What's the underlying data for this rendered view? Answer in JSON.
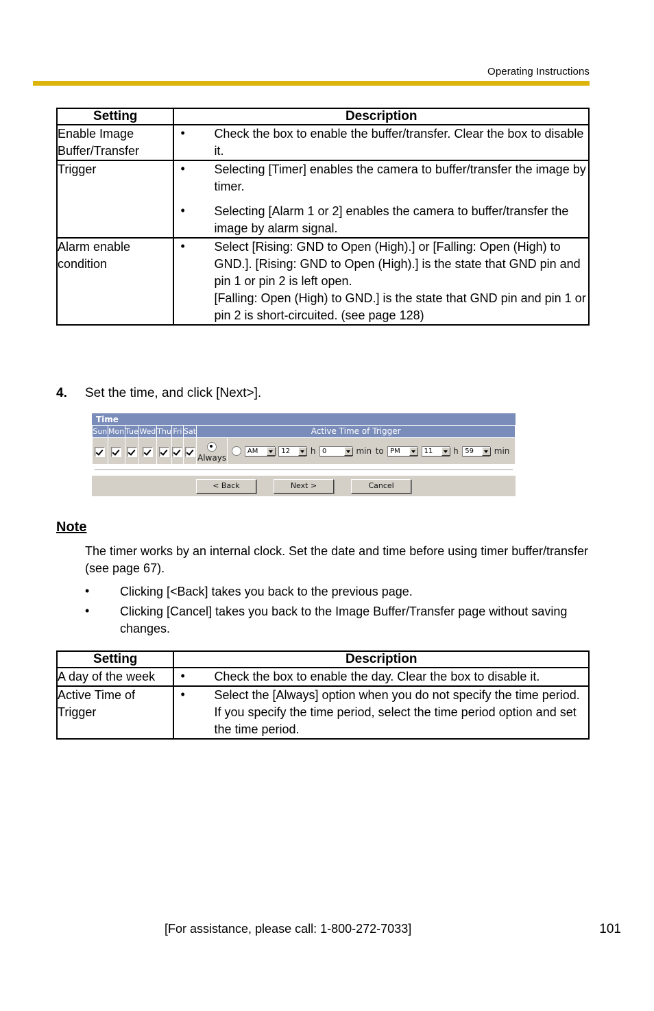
{
  "header": {
    "title": "Operating Instructions",
    "rule_color": "#dcb40b"
  },
  "table1": {
    "columns": [
      "Setting",
      "Description"
    ],
    "rows": [
      {
        "setting": "Enable Image Buffer/Transfer",
        "bullets": [
          "Check the box to enable the buffer/transfer. Clear the box to disable it."
        ]
      },
      {
        "setting": "Trigger",
        "bullets": [
          "Selecting [Timer] enables the camera to buffer/transfer the image by timer.",
          "Selecting [Alarm 1 or 2] enables the camera to buffer/transfer the image by alarm signal."
        ]
      },
      {
        "setting": "Alarm enable condition",
        "bullets": [
          "Select [Rising: GND to Open (High).] or [Falling: Open (High) to GND.]. [Rising: GND to Open (High).] is the state that GND pin and pin 1 or pin 2 is left open.\n[Falling: Open (High) to GND.] is the state that GND pin and pin 1 or pin 2 is short-circuited. (see page 128)"
        ]
      }
    ]
  },
  "step": {
    "number": "4.",
    "text": "Set the time, and click [Next>]."
  },
  "camera_ui": {
    "title": "Time",
    "day_headers": [
      "Sun",
      "Mon",
      "Tue",
      "Wed",
      "Thu",
      "Fri",
      "Sat"
    ],
    "day_checked": [
      true,
      true,
      true,
      true,
      true,
      true,
      true
    ],
    "active_time_header": "Active Time of Trigger",
    "always_label": "Always",
    "always_selected": true,
    "period_selected": false,
    "period": {
      "from_meridiem": "AM",
      "from_hour": "12",
      "hour_unit": "h",
      "from_minute": "0",
      "minute_unit": "min",
      "to_label": "to",
      "to_meridiem": "PM",
      "to_hour": "11",
      "to_minute": "59"
    },
    "buttons": [
      "< Back",
      "Next >",
      "Cancel"
    ],
    "colors": {
      "titlebar": "#7a8cba",
      "header_row": "#7a8cba",
      "cell_bg": "#d4d0c8"
    }
  },
  "note": {
    "heading": "Note",
    "paragraph": "The timer works by an internal clock. Set the date and time before using timer buffer/transfer (see page 67).",
    "bullets": [
      "Clicking [<Back] takes you back to the previous page.",
      "Clicking [Cancel] takes you back to the Image Buffer/Transfer page without saving changes."
    ]
  },
  "table2": {
    "columns": [
      "Setting",
      "Description"
    ],
    "rows": [
      {
        "setting": "A day of the week",
        "bullets": [
          "Check the box to enable the day. Clear the box to disable it."
        ]
      },
      {
        "setting": "Active Time of Trigger",
        "bullets": [
          "Select the [Always] option when you do not specify the time period. If you specify the time period, select the time period option and set the time period."
        ]
      }
    ]
  },
  "footer": {
    "assistance": "[For assistance, please call: 1-800-272-7033]",
    "page_number": "101"
  }
}
